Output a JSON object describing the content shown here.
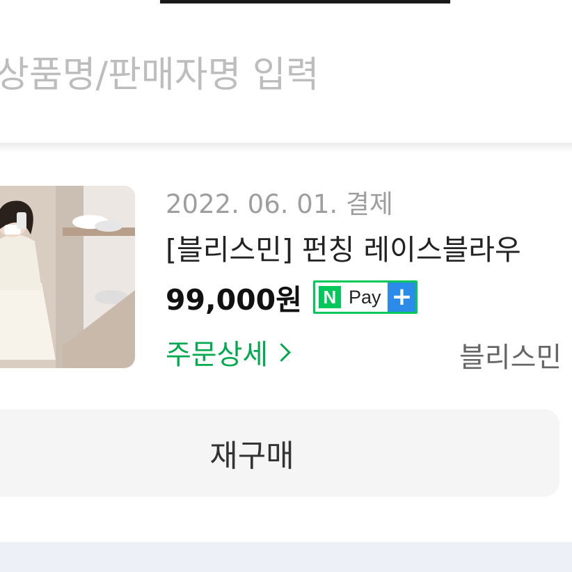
{
  "search": {
    "placeholder": "상품명/판매자명 입력"
  },
  "order": {
    "date": "2022. 06. 01. 결제",
    "product_name": "[블리스민] 펀칭 레이스블라우",
    "price": "99,000원",
    "npay": {
      "n_label": "N",
      "pay_label": "Pay",
      "plus_label": "+"
    },
    "detail_link": "주문상세",
    "seller": "블리스민",
    "rebuy_button": "재구매"
  },
  "colors": {
    "accent_green": "#03c75a",
    "link_green": "#03a94f",
    "npay_blue": "#2b8be8",
    "placeholder_gray": "#bdbdbd",
    "date_gray": "#9e9e9e"
  }
}
